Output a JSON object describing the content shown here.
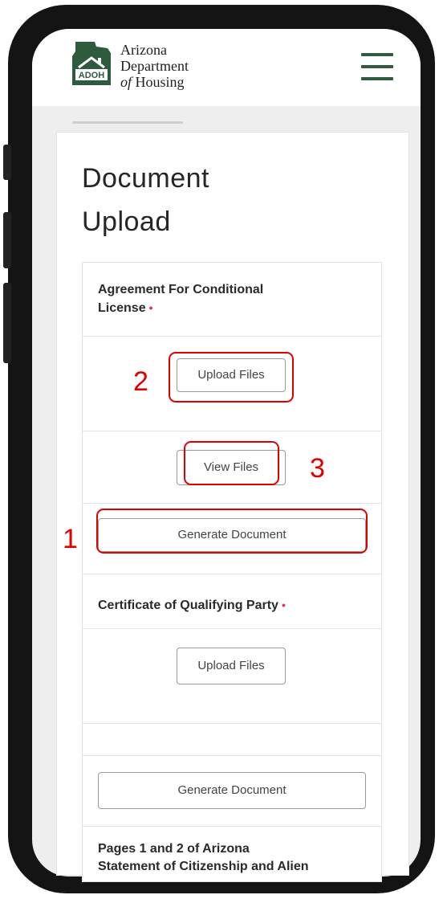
{
  "brand": {
    "line1": "Arizona",
    "line2": "Department",
    "line3_italic": "of",
    "line3_rest": " Housing",
    "logo_badge": "ADOH",
    "accent_color": "#2e5a3e"
  },
  "header": {
    "menu_icon": "hamburger-menu-icon"
  },
  "page": {
    "title_line1": "Document",
    "title_line2": "Upload"
  },
  "sections": [
    {
      "label_line1": "Agreement For Conditional",
      "label_line2": "License",
      "required_mark": "•",
      "upload_label": "Upload Files",
      "view_label": "View Files",
      "generate_label": "Generate Document"
    },
    {
      "label_line1": "Certificate of Qualifying Party",
      "required_mark": "•",
      "upload_label": "Upload Files",
      "generate_label": "Generate Document"
    },
    {
      "label_line1": "Pages 1 and 2 of Arizona",
      "label_line2": "Statement of Citizenship and Alien"
    }
  ],
  "annotations": {
    "n1": "1",
    "n2": "2",
    "n3": "3",
    "color": "#e00000"
  }
}
